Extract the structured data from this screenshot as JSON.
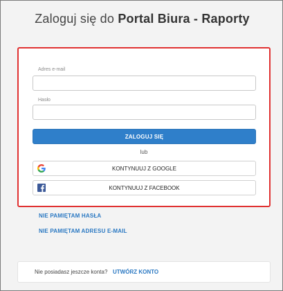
{
  "header": {
    "title_prefix": "Zaloguj się do",
    "title_bold": "Portal Biura - Raporty"
  },
  "login_form": {
    "email_label": "Adres e-mail",
    "email_value": "",
    "password_label": "Hasło",
    "password_value": "",
    "submit_label": "ZALOGUJ SIĘ",
    "or_text": "lub",
    "google_label": "KONTYNUUJ Z GOOGLE",
    "facebook_label": "KONTYNUUJ Z FACEBOOK"
  },
  "links": {
    "forgot_password": "NIE PAMIĘTAM HASŁA",
    "forgot_email": "NIE PAMIĘTAM ADRESU E-MAIL"
  },
  "signup": {
    "prompt": "Nie posiadasz jeszcze konta?",
    "link_label": "UTWÓRZ KONTO"
  },
  "colors": {
    "primary": "#2f7fca",
    "link": "#2a78c2",
    "highlight_border": "#e03131",
    "facebook": "#3b5998"
  },
  "icons": {
    "google": "google-icon",
    "facebook": "facebook-icon"
  }
}
